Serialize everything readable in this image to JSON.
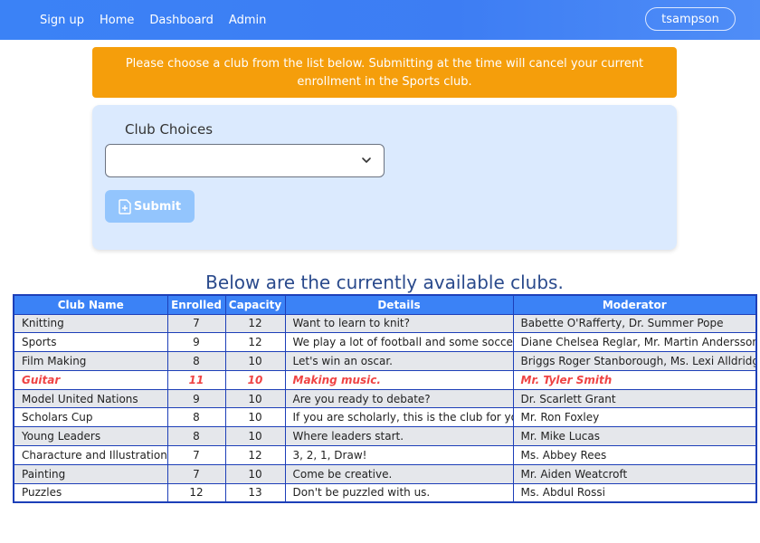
{
  "nav": {
    "links": [
      "Sign up",
      "Home",
      "Dashboard",
      "Admin"
    ],
    "user": "tsampson"
  },
  "alert": {
    "text": "Please choose a club from the list below. Submitting at the time will cancel your current enrollment in the Sports club."
  },
  "form": {
    "label": "Club Choices",
    "selected_value": "",
    "submit_label": "Submit"
  },
  "clubs_section": {
    "title": "Below are the currently available clubs.",
    "columns": [
      "Club Name",
      "Enrolled",
      "Capacity",
      "Details",
      "Moderator"
    ],
    "rows": [
      {
        "name": "Knitting",
        "enrolled": "7",
        "capacity": "12",
        "details": "Want to learn to knit?",
        "moderator": "Babette O'Rafferty, Dr. Summer Pope"
      },
      {
        "name": "Sports",
        "enrolled": "9",
        "capacity": "12",
        "details": "We play a lot of football and some soccer.",
        "moderator": "Diane Chelsea Reglar, Mr. Martin Andersson"
      },
      {
        "name": "Film Making",
        "enrolled": "8",
        "capacity": "10",
        "details": "Let's win an oscar.",
        "moderator": "Briggs Roger Stanborough, Ms. Lexi Alldridge"
      },
      {
        "name": "Guitar",
        "enrolled": "11",
        "capacity": "10",
        "details": "Making music.",
        "moderator": "Mr. Tyler Smith"
      },
      {
        "name": "Model United Nations",
        "enrolled": "9",
        "capacity": "10",
        "details": "Are you ready to debate?",
        "moderator": "Dr. Scarlett Grant"
      },
      {
        "name": "Scholars Cup",
        "enrolled": "8",
        "capacity": "10",
        "details": "If you are scholarly, this is the club for you.",
        "moderator": "Mr. Ron Foxley"
      },
      {
        "name": "Young Leaders",
        "enrolled": "8",
        "capacity": "10",
        "details": "Where leaders start.",
        "moderator": "Mr. Mike Lucas"
      },
      {
        "name": "Characture and Illustrations",
        "enrolled": "7",
        "capacity": "12",
        "details": "3, 2, 1, Draw!",
        "moderator": "Ms. Abbey Rees"
      },
      {
        "name": "Painting",
        "enrolled": "7",
        "capacity": "10",
        "details": "Come be creative.",
        "moderator": "Mr. Aiden Weatcroft"
      },
      {
        "name": "Puzzles",
        "enrolled": "12",
        "capacity": "13",
        "details": "Don't be puzzled with us.",
        "moderator": "Ms. Abdul Rossi"
      }
    ]
  },
  "colors": {
    "navbar": "#3b82f6",
    "alert": "#f59e0b",
    "card": "#dbeafe",
    "table_header": "#3b82f6",
    "over_capacity": "#ef4444"
  },
  "icons": {
    "select": "chevron-down-icon",
    "submit": "file-plus-icon"
  }
}
